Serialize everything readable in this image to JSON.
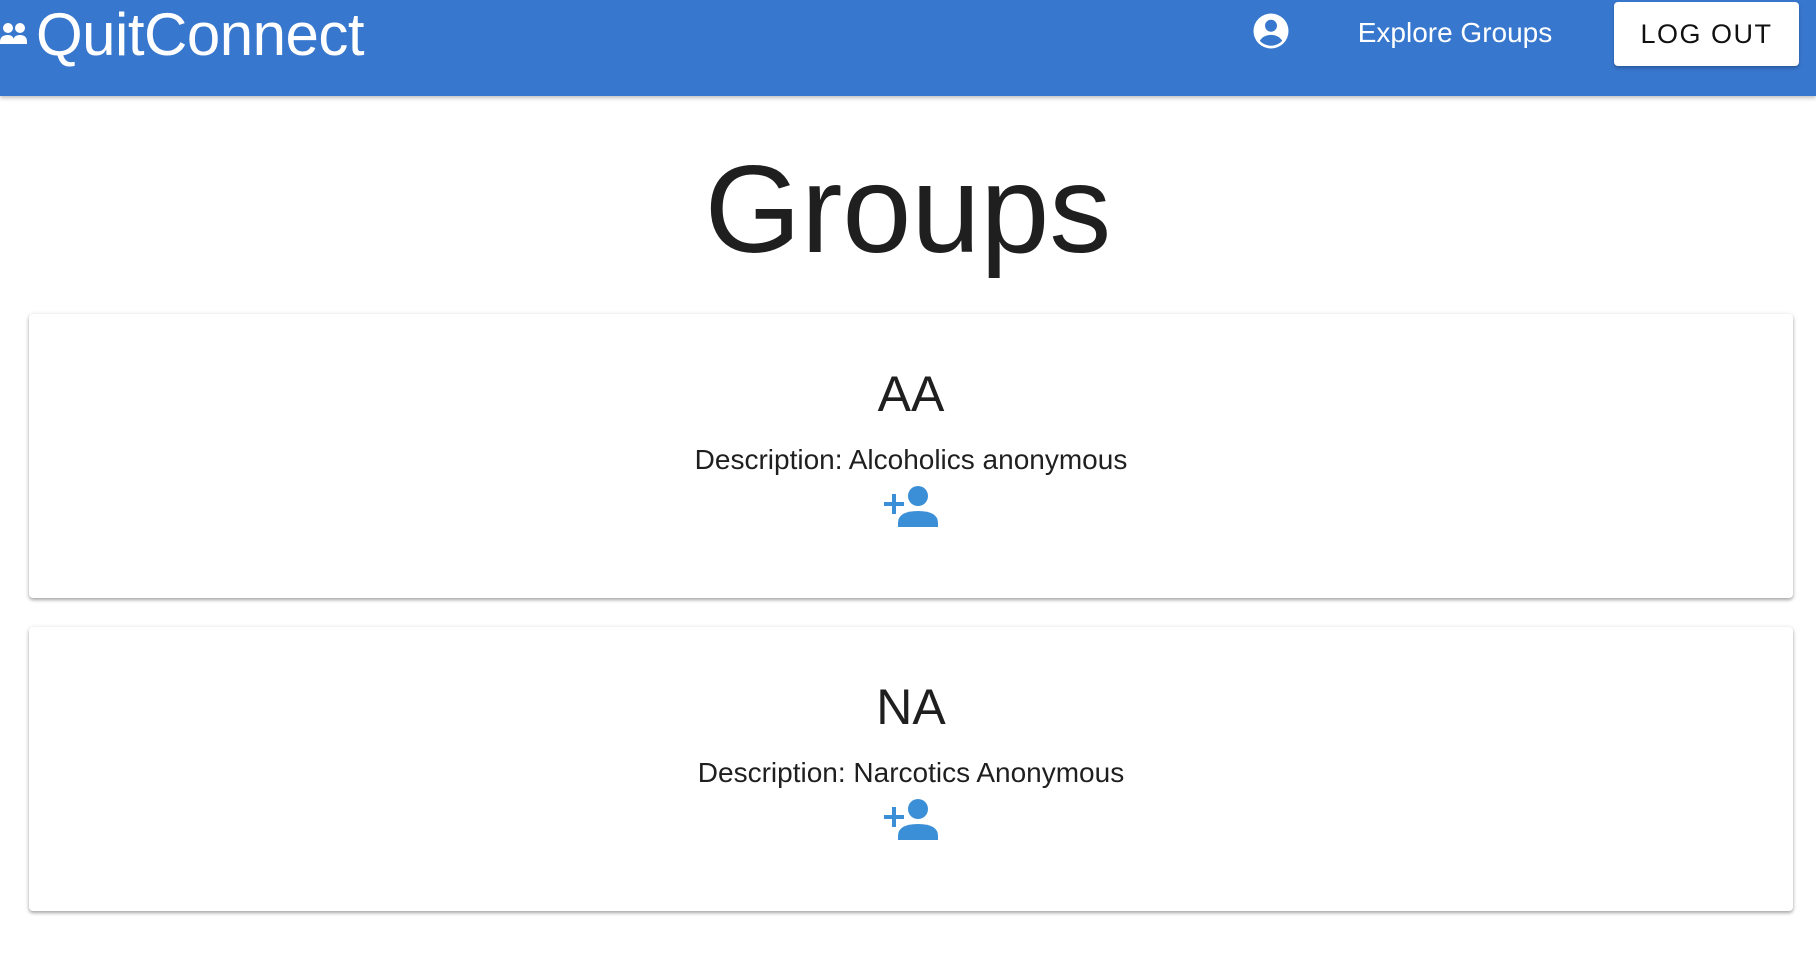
{
  "header": {
    "brand": "QuitConnect",
    "nav_explore": "Explore Groups",
    "logout_label": "LOG OUT",
    "bar_color": "#3877ce"
  },
  "main": {
    "title": "Groups",
    "groups": [
      {
        "name": "AA",
        "description": "Description: Alcoholics anonymous",
        "action_icon": "person-add-icon"
      },
      {
        "name": "NA",
        "description": "Description: Narcotics Anonymous",
        "action_icon": "person-add-icon"
      }
    ]
  },
  "icons": {
    "brand": "groups-icon",
    "account": "account-circle-icon",
    "join": "person-add-icon"
  },
  "colors": {
    "accent": "#3877ce",
    "icon_blue": "#3b8fd6",
    "text": "#212121"
  }
}
